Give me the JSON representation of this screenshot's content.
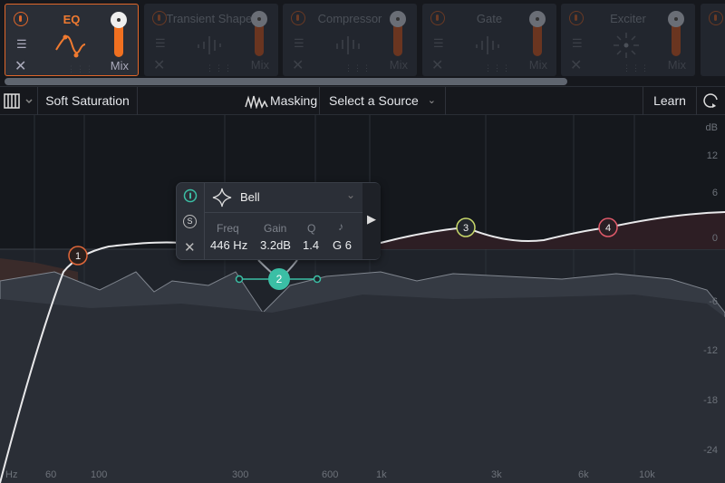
{
  "modules": [
    {
      "title": "EQ",
      "mix_label": "Mix",
      "active": true
    },
    {
      "title": "Transient Shaper",
      "mix_label": "Mix",
      "active": false
    },
    {
      "title": "Compressor",
      "mix_label": "Mix",
      "active": false
    },
    {
      "title": "Gate",
      "mix_label": "Mix",
      "active": false
    },
    {
      "title": "Exciter",
      "mix_label": "Mix",
      "active": false
    }
  ],
  "toolbar": {
    "preset": "Soft Saturation",
    "masking": "Masking",
    "source": "Select a Source",
    "learn": "Learn"
  },
  "band_popup": {
    "shape": "Bell",
    "freq_label": "Freq",
    "freq": "446 Hz",
    "gain_label": "Gain",
    "gain": "3.2dB",
    "q_label": "Q",
    "q": "1.4",
    "note": "G 6",
    "solo": "S"
  },
  "nodes": [
    "1",
    "2",
    "3",
    "4"
  ],
  "db_axis": {
    "unit": "dB",
    "ticks": [
      "12",
      "6",
      "0",
      "-6",
      "-12",
      "-18",
      "-24"
    ]
  },
  "freq_axis": {
    "unit": "Hz",
    "ticks": [
      "60",
      "100",
      "300",
      "600",
      "1k",
      "3k",
      "6k",
      "10k"
    ]
  },
  "colors": {
    "accent": "#f07020",
    "band1": "#e0673a",
    "band2": "#3bbfa5",
    "band3": "#c8d86a",
    "band4": "#e05a6a"
  }
}
